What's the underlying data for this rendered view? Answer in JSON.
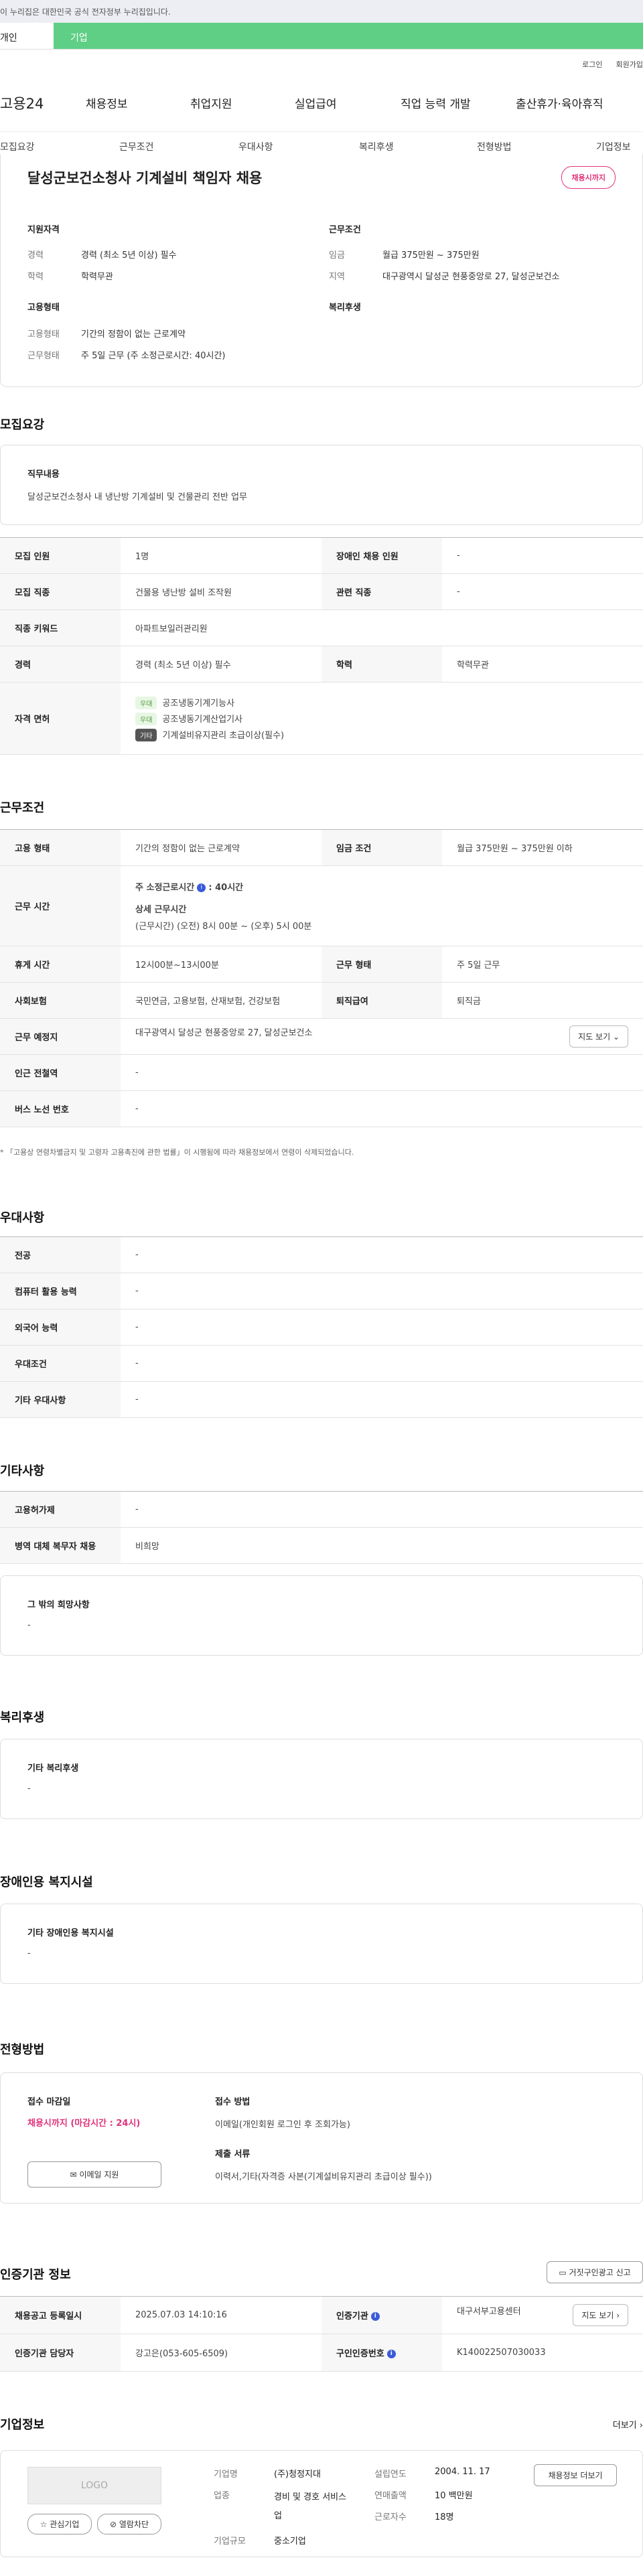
{
  "gov_banner": "이 누리집은 대한민국 공식 전자정부 누리집입니다.",
  "user_tabs": {
    "person": "개인",
    "org": "기업"
  },
  "top_links": {
    "login": "로그인",
    "join": "회원가입"
  },
  "gnb": {
    "logo": "고용24",
    "items": [
      "채용정보",
      "취업지원",
      "실업급여",
      "직업 능력 개발",
      "출산휴가·육아휴직"
    ]
  },
  "subnav": [
    "모집요강",
    "근무조건",
    "우대사항",
    "복리후생",
    "전형방법",
    "기업정보"
  ],
  "job": {
    "title": "달성군보건소청사 기계설비 책임자 채용",
    "status": "채용시까지",
    "summary": {
      "h_qual": "지원자격",
      "k_career": "경력",
      "v_career": "경력 (최소 5년 이상) 필수",
      "k_edu": "학력",
      "v_edu": "학력무관",
      "h_cond": "근무조건",
      "k_wage": "임금",
      "v_wage": "월급 375만원 ~ 375만원",
      "k_region": "지역",
      "v_region": "대구광역시 달성군 현풍중앙로 27, 달성군보건소",
      "h_emp": "고용형태",
      "k_emptype": "고용형태",
      "v_emptype": "기간의 정함이 없는 근로계약",
      "k_worktype": "근무형태",
      "v_worktype": "주 5일 근무 (주 소정근로시간: 40시간)",
      "h_welfare": "복리후생"
    }
  },
  "recruit": {
    "title": "모집요강",
    "duty_h": "직무내용",
    "duty_v": "달성군보건소청사 내 냉난방 기계설비 및 건물관리 전반 업무",
    "rows": {
      "k_count": "모집 인원",
      "v_count": "1명",
      "k_disabled": "장애인 채용 인원",
      "v_disabled": "-",
      "k_job": "모집 직종",
      "v_job": "건물용 냉난방 설비 조작원",
      "k_rel": "관련 직종",
      "v_rel": "-",
      "k_kw": "직종 키워드",
      "v_kw": "아파트보일러관리원",
      "k_career": "경력",
      "v_career": "경력 (최소 5년 이상) 필수",
      "k_edu": "학력",
      "v_edu": "학력무관",
      "k_license": "자격 면허",
      "lic": [
        {
          "chip": "우대",
          "name": "공조냉동기계기능사"
        },
        {
          "chip": "우대",
          "name": "공조냉동기계산업기사"
        },
        {
          "chip": "기타",
          "name": "기계설비유지관리 초급이상(필수)"
        }
      ]
    }
  },
  "conditions": {
    "title": "근무조건",
    "k_emp": "고용 형태",
    "v_emp": "기간의 정함이 없는 근로계약",
    "k_wage": "임금 조건",
    "v_wage": "월급 375만원 ~ 375만원 이하",
    "k_hours": "근무 시간",
    "v_hours_h": "주 소정근로시간",
    "v_hours_v": ": 40시간",
    "v_detail_h": "상세 근무시간",
    "v_detail_v": "(근무시간) (오전) 8시 00분 ~ (오후) 5시 00분",
    "k_rest": "휴게 시간",
    "v_rest": "12시00분~13시00분",
    "k_form": "근무 형태",
    "v_form": "주 5일 근무",
    "k_ins": "사회보험",
    "v_ins": "국민연금, 고용보험, 산재보험, 건강보험",
    "k_ret": "퇴직급여",
    "v_ret": "퇴직금",
    "k_place": "근무 예정지",
    "v_place": "대구광역시 달성군 현풍중앙로 27, 달성군보건소",
    "map_btn": "지도 보기",
    "k_subway": "인근 전철역",
    "v_subway": "-",
    "k_bus": "버스 노선 번호",
    "v_bus": "-",
    "note": "* 「고용상 연령차별금지 및 고령자 고용촉진에 관한 법률」이 시행됨에 따라 채용정보에서 연령이 삭제되었습니다."
  },
  "pref": {
    "title": "우대사항",
    "k_major": "전공",
    "v_major": "-",
    "k_pc": "컴퓨터 활용 능력",
    "v_pc": "-",
    "k_lang": "외국어 능력",
    "v_lang": "-",
    "k_cond": "우대조건",
    "v_cond": "-",
    "k_etc": "기타 우대사항",
    "v_etc": "-"
  },
  "etc": {
    "title": "기타사항",
    "k_dev": "고용허가제",
    "v_dev": "-",
    "k_mil": "병역 대체 복무자 채용",
    "v_mil": "비희망",
    "other_h": "그 밖의 희망사항",
    "other_v": "-"
  },
  "welfare": {
    "title": "복리후생",
    "h": "기타 복리후생",
    "v": "-"
  },
  "disab": {
    "title": "장애인용 복지시설",
    "h": "기타 장애인용 복지시설",
    "v": "-"
  },
  "process": {
    "title": "전형방법",
    "deadline_h": "접수 마감일",
    "deadline_v": "채용시까지 (마감시간 : 24시)",
    "method_h": "접수 방법",
    "method_v": "이메일(개인회원 로그인 후 조회가능)",
    "docs_h": "제출 서류",
    "docs_v": "이력서,기타(자격증 사본(기계설비유지관리 초급이상 필수))",
    "email_btn": "이메일 지원"
  },
  "cert": {
    "title": "인증기관 정보",
    "report_btn": "거짓구인광고 신고",
    "k_reg": "채용공고 등록일시",
    "v_reg": "2025.07.03 14:10:16",
    "k_org": "인증기관",
    "v_org": "대구서부고용센터",
    "map_btn": "지도 보기",
    "k_mgr": "인증기관 담당자",
    "v_mgr": "강고은(053-605-6509)",
    "k_no": "구인인증번호",
    "v_no": "K140022507030033"
  },
  "company": {
    "title": "기업정보",
    "more": "더보기",
    "logo": "LOGO",
    "fav_btn": "관심기업",
    "block_btn": "열람차단",
    "k_name": "기업명",
    "v_name": "(주)청정지대",
    "k_ind": "업종",
    "v_ind": "경비 및 경호 서비스업",
    "k_size": "기업규모",
    "v_size": "중소기업",
    "k_est": "설립연도",
    "v_est": "2004. 11. 17",
    "k_sales": "연매출액",
    "v_sales": "10 백만원",
    "k_emp": "근로자수",
    "v_emp": "18명",
    "jobs_btn": "채용정보 더보기"
  }
}
